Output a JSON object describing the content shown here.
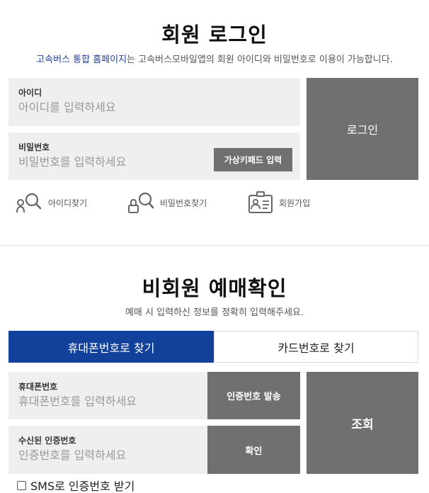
{
  "login": {
    "title": "회원 로그인",
    "subtitle_accent": "고속버스 통합 홈페이지",
    "subtitle_rest": "는 고속버스모바일앱의 회원 아이디와 비밀번호로 이용이 가능합니다.",
    "id_label": "아이디",
    "id_placeholder": "아이디를 입력하세요",
    "pw_label": "비밀번호",
    "pw_placeholder": "비밀번호를 입력하세요",
    "keypad_button": "가상키패드 입력",
    "login_button": "로그인",
    "links": [
      {
        "label": "아이디찾기",
        "icon": "find-id-icon"
      },
      {
        "label": "비밀번호찾기",
        "icon": "find-password-icon"
      },
      {
        "label": "회원가입",
        "icon": "signup-icon"
      }
    ]
  },
  "guest": {
    "title": "비회원 예매확인",
    "subtitle": "예매 시 입력하신 정보를 정확히 입력해주세요.",
    "tabs": [
      {
        "label": "휴대폰번호로 찾기",
        "active": true
      },
      {
        "label": "카드번호로 찾기",
        "active": false
      }
    ],
    "phone_label": "휴대폰번호",
    "phone_placeholder": "휴대폰번호를 입력하세요",
    "send_code_button": "인증번호 발송",
    "code_label": "수신된 인증번호",
    "code_placeholder": "인증번호를 입력하세요",
    "confirm_button": "확인",
    "search_button": "조회",
    "sms_checkbox_label": "SMS로 인증번호 받기"
  },
  "colors": {
    "accent": "#12419b",
    "button_gray": "#707070",
    "field_bg": "#efefef"
  }
}
